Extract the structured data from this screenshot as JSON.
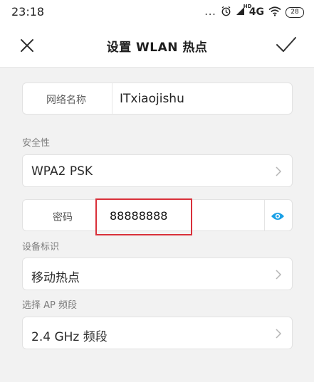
{
  "status_bar": {
    "time": "23:18",
    "more_dots": "...",
    "network": "4G",
    "hd_badge": "HD",
    "battery": "28",
    "icons": [
      "alarm-icon",
      "signal-icon",
      "wifi-icon",
      "battery-icon"
    ]
  },
  "app_bar": {
    "title": "设置 WLAN 热点",
    "close_icon": "close-icon",
    "confirm_icon": "check-icon"
  },
  "network_name": {
    "label": "网络名称",
    "value": "ITxiaojishu"
  },
  "security": {
    "section_label": "安全性",
    "value": "WPA2 PSK"
  },
  "password": {
    "label": "密码",
    "value": "88888888",
    "toggle_icon": "eye-icon"
  },
  "device_id": {
    "section_label": "设备标识",
    "value": "移动热点"
  },
  "ap_band": {
    "section_label": "选择 AP 频段",
    "value": "2.4 GHz 频段"
  },
  "colors": {
    "accent": "#1aa0e6",
    "highlight": "#d9303a",
    "background": "#f2f2f2"
  }
}
